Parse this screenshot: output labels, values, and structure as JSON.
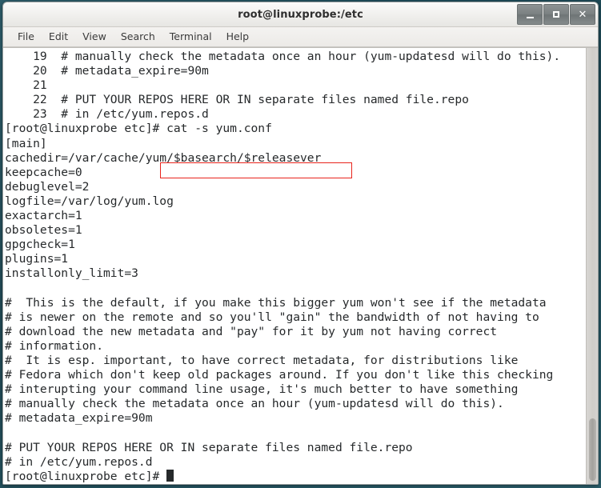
{
  "window": {
    "title": "root@linuxprobe:/etc",
    "controls": [
      {
        "name": "minimize",
        "label": "–"
      },
      {
        "name": "maximize",
        "label": "□"
      },
      {
        "name": "close",
        "label": "✕"
      }
    ]
  },
  "menubar": {
    "items": [
      "File",
      "Edit",
      "View",
      "Search",
      "Terminal",
      "Help"
    ]
  },
  "terminal": {
    "prompt": "[root@linuxprobe etc]#",
    "command": " cat -s yum.conf",
    "highlight_color": "#e8241c",
    "lines": [
      "    19  # manually check the metadata once an hour (yum-updatesd will do this).",
      "    20  # metadata_expire=90m",
      "    21",
      "    22  # PUT YOUR REPOS HERE OR IN separate files named file.repo",
      "    23  # in /etc/yum.repos.d",
      "[root@linuxprobe etc]# cat -s yum.conf",
      "[main]",
      "cachedir=/var/cache/yum/$basearch/$releasever",
      "keepcache=0",
      "debuglevel=2",
      "logfile=/var/log/yum.log",
      "exactarch=1",
      "obsoletes=1",
      "gpgcheck=1",
      "plugins=1",
      "installonly_limit=3",
      "",
      "#  This is the default, if you make this bigger yum won't see if the metadata",
      "# is newer on the remote and so you'll \"gain\" the bandwidth of not having to",
      "# download the new metadata and \"pay\" for it by yum not having correct",
      "# information.",
      "#  It is esp. important, to have correct metadata, for distributions like",
      "# Fedora which don't keep old packages around. If you don't like this checking",
      "# interupting your command line usage, it's much better to have something",
      "# manually check the metadata once an hour (yum-updatesd will do this).",
      "# metadata_expire=90m",
      "",
      "# PUT YOUR REPOS HERE OR IN separate files named file.repo",
      "# in /etc/yum.repos.d"
    ],
    "last_prompt": "[root@linuxprobe etc]# "
  },
  "scrollbar": {
    "position": "bottom"
  }
}
